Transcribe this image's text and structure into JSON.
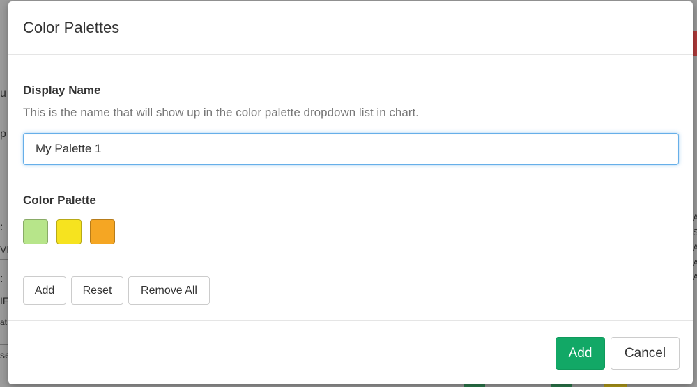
{
  "background": {
    "fragments": [
      "u",
      "p",
      ":",
      "VE",
      ":",
      "IF",
      "at",
      "se"
    ],
    "right_fragments": [
      "A",
      "S",
      "A",
      "A",
      "A"
    ]
  },
  "dialog": {
    "title": "Color Palettes",
    "display_name": {
      "label": "Display Name",
      "help": "This is the name that will show up in the color palette dropdown list in chart.",
      "value": "My Palette 1"
    },
    "color_palette": {
      "label": "Color Palette",
      "swatches": [
        {
          "name": "light-green",
          "color": "#b7e58a"
        },
        {
          "name": "yellow",
          "color": "#f6e31f"
        },
        {
          "name": "orange",
          "color": "#f5a623"
        }
      ],
      "buttons": {
        "add": "Add",
        "reset": "Reset",
        "remove_all": "Remove All"
      }
    },
    "footer": {
      "add": "Add",
      "cancel": "Cancel"
    }
  },
  "colors": {
    "primary": "#12a866",
    "focus_border": "#66afe9"
  }
}
